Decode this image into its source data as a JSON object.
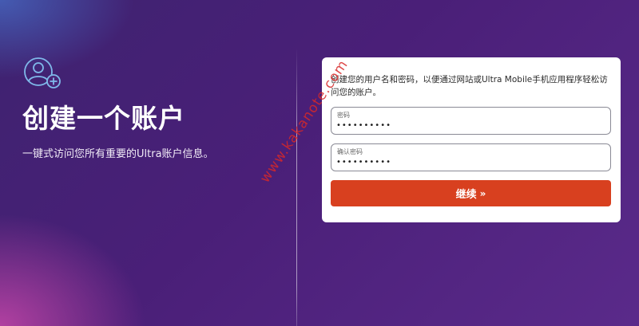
{
  "hero": {
    "icon": "user-add-icon",
    "title": "创建一个账户",
    "subtitle": "一键式访问您所有重要的Ultra账户信息。"
  },
  "form": {
    "intro": "创建您的用户名和密码，以便通过网站或Ultra Mobile手机应用程序轻松访问您的账户。",
    "password": {
      "label": "密码",
      "value": "••••••••••"
    },
    "confirm_password": {
      "label": "确认密码",
      "value": "••••••••••"
    },
    "submit_label": "继续",
    "submit_icon": "double-chevron-right-icon"
  },
  "watermark": "www.kakanote.com",
  "colors": {
    "accent": "#d8401f",
    "background": "#4a1f78",
    "card": "#ffffff"
  }
}
